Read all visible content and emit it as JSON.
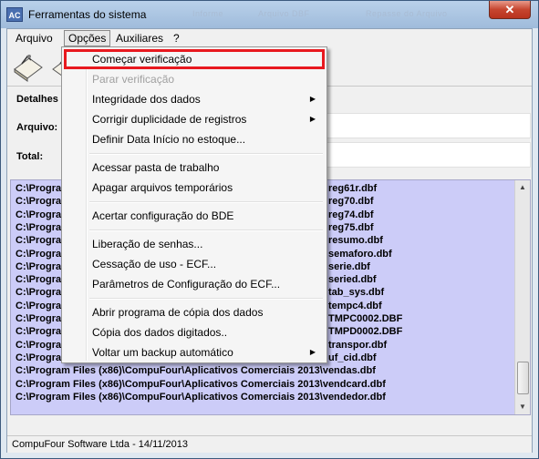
{
  "window": {
    "title": "Ferramentas do sistema",
    "app_icon_text": "AC",
    "close_symbol": "✕",
    "ghost_tabs": [
      "Informe",
      "Arquivo DBF",
      "Repasse do Arquivo"
    ]
  },
  "menubar": {
    "items": [
      "Arquivo",
      "Opções",
      "Auxiliares",
      "?"
    ]
  },
  "form": {
    "detalhes_label": "Detalhes",
    "arquivo_label": "Arquivo:",
    "total_label": "Total:"
  },
  "list": {
    "prefix": "C:\\Program",
    "rows": [
      "reg61r.dbf",
      "reg70.dbf",
      "reg74.dbf",
      "reg75.dbf",
      "resumo.dbf",
      "semaforo.dbf",
      "serie.dbf",
      "seried.dbf",
      "tab_sys.dbf",
      "tempc4.dbf",
      "TMPC0002.DBF",
      "TMPD0002.DBF",
      "transpor.dbf",
      "uf_cid.dbf"
    ],
    "full_rows": [
      "C:\\Program Files (x86)\\CompuFour\\Aplicativos Comerciais 2013\\vendas.dbf",
      "C:\\Program Files (x86)\\CompuFour\\Aplicativos Comerciais 2013\\vendcard.dbf",
      "C:\\Program Files (x86)\\CompuFour\\Aplicativos Comerciais 2013\\vendedor.dbf"
    ]
  },
  "dropdown": {
    "groups": [
      [
        {
          "label": "Começar verificação",
          "state": "highlight"
        },
        {
          "label": "Parar verificação",
          "state": "disabled"
        },
        {
          "label": "Integridade dos dados",
          "submenu": true
        },
        {
          "label": "Corrigir duplicidade de registros",
          "submenu": true
        },
        {
          "label": "Definir Data Início no estoque..."
        }
      ],
      [
        {
          "label": "Acessar pasta de trabalho"
        },
        {
          "label": "Apagar arquivos temporários"
        }
      ],
      [
        {
          "label": "Acertar configuração do BDE"
        }
      ],
      [
        {
          "label": "Liberação de senhas..."
        },
        {
          "label": "Cessação de uso - ECF..."
        },
        {
          "label": "Parâmetros de Configuração  do ECF..."
        }
      ],
      [
        {
          "label": "Abrir programa de cópia dos dados"
        },
        {
          "label": "Cópia dos dados digitados.."
        },
        {
          "label": "Voltar um backup automático",
          "submenu": true
        }
      ]
    ]
  },
  "status": {
    "text": "CompuFour Software Ltda - 14/11/2013"
  },
  "colors": {
    "highlight_border": "#e8191f",
    "list_background": "#ccccf8"
  }
}
